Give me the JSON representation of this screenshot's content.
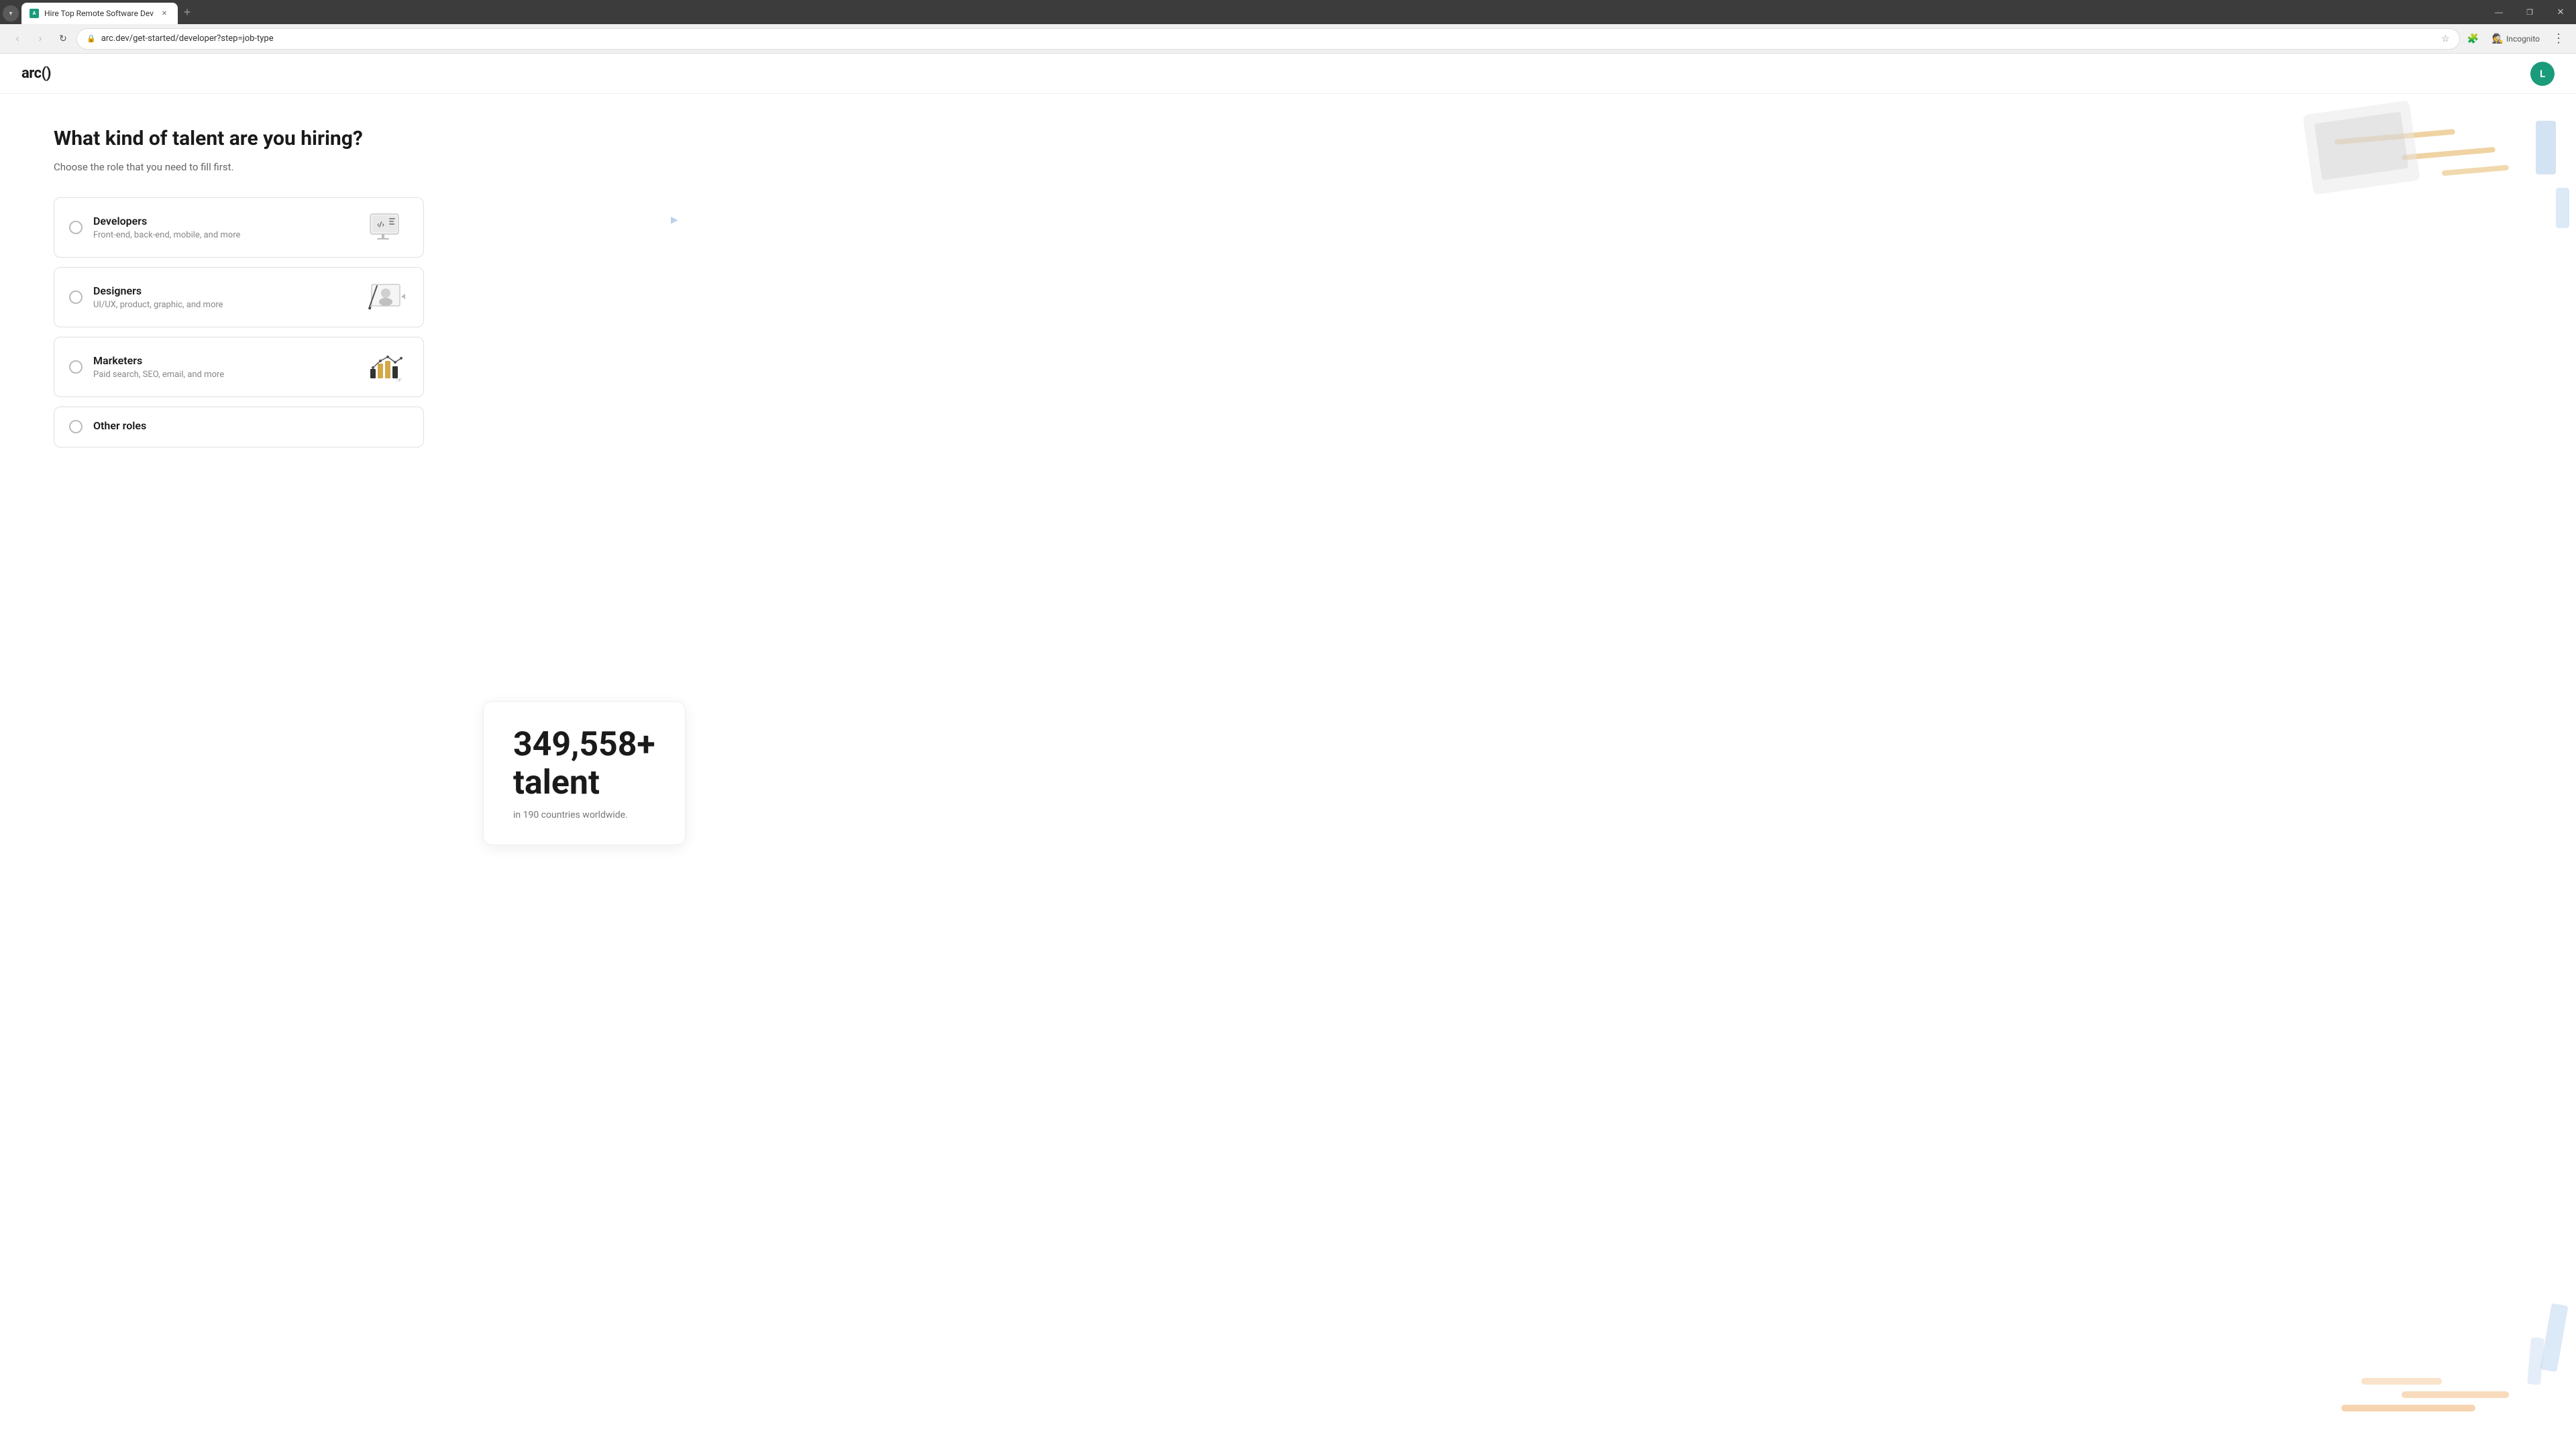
{
  "browser": {
    "tab_title": "Hire Top Remote Software Dev",
    "tab_favicon": "A",
    "url": "arc.dev/get-started/developer?step=job-type",
    "incognito_label": "Incognito",
    "new_tab_label": "+"
  },
  "header": {
    "logo": "arc()",
    "user_initial": "L"
  },
  "page": {
    "heading": "What kind of talent are you hiring?",
    "subtitle": "Choose the role that you need to fill first.",
    "options": [
      {
        "id": "developers",
        "title": "Developers",
        "description": "Front-end, back-end, mobile, and more",
        "selected": false
      },
      {
        "id": "designers",
        "title": "Designers",
        "description": "UI/UX, product, graphic, and more",
        "selected": false
      },
      {
        "id": "marketers",
        "title": "Marketers",
        "description": "Paid search, SEO, email, and more",
        "selected": false
      },
      {
        "id": "other",
        "title": "Other roles",
        "description": "",
        "selected": false
      }
    ]
  },
  "stats": {
    "number": "349,558+",
    "label": "talent",
    "description": "in 190 countries worldwide."
  },
  "colors": {
    "accent": "#1a9b7a",
    "gold": "#d4a849",
    "light_gold": "#e8c97a",
    "light_blue": "#a8c8e8",
    "light_orange": "#f0b87a"
  }
}
